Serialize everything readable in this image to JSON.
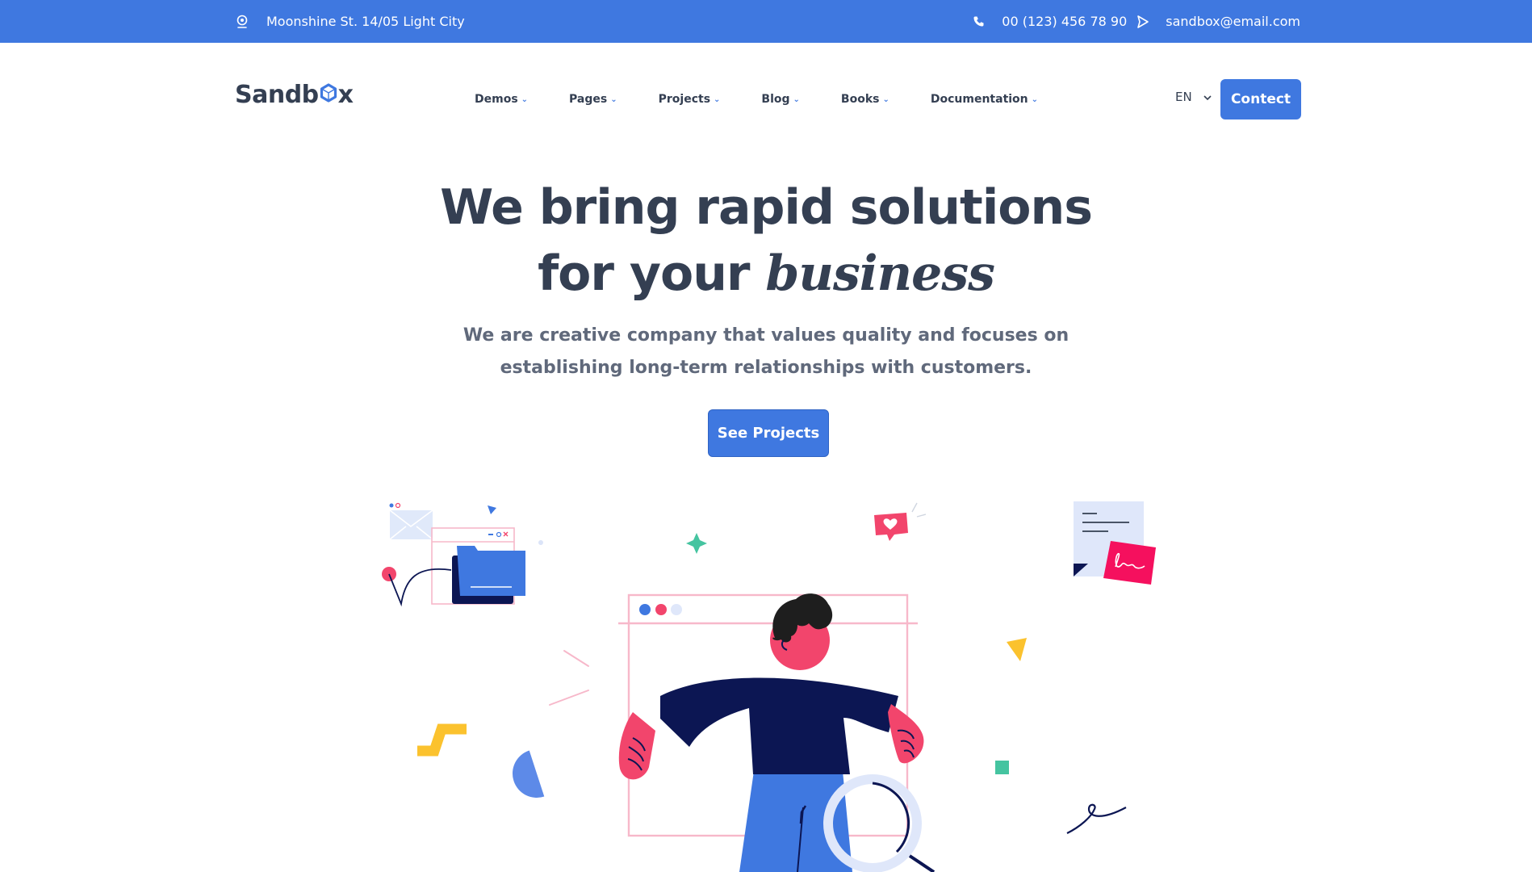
{
  "topbar": {
    "address": "Moonshine St. 14/05 Light City",
    "phone": "00 (123) 456 78 90",
    "email": "sandbox@email.com",
    "location_icon": "location-pin-icon",
    "phone_icon": "phone-icon",
    "email_icon": "send-icon"
  },
  "navbar": {
    "logo": "Sandbox",
    "items": [
      {
        "label": "Demos"
      },
      {
        "label": "Pages"
      },
      {
        "label": "Projects"
      },
      {
        "label": "Blog"
      },
      {
        "label": "Books"
      },
      {
        "label": "Documentation"
      }
    ],
    "language": "EN",
    "contact_label": "Contect"
  },
  "hero": {
    "title_line1": "We bring rapid solutions",
    "title_line2_prefix": "for your ",
    "title_line2_emphasis": "business",
    "subtitle_line1": "We are creative company that values quality and focuses on",
    "subtitle_line2": "establishing long-term relationships with customers.",
    "button_label": "See Projects"
  },
  "colors": {
    "primary": "#3f78e0",
    "text": "#343f52",
    "muted": "#60697b",
    "pink": "#f2456c",
    "navy": "#0c1653",
    "yellow": "#fbc22e",
    "green": "#45c4a0"
  }
}
